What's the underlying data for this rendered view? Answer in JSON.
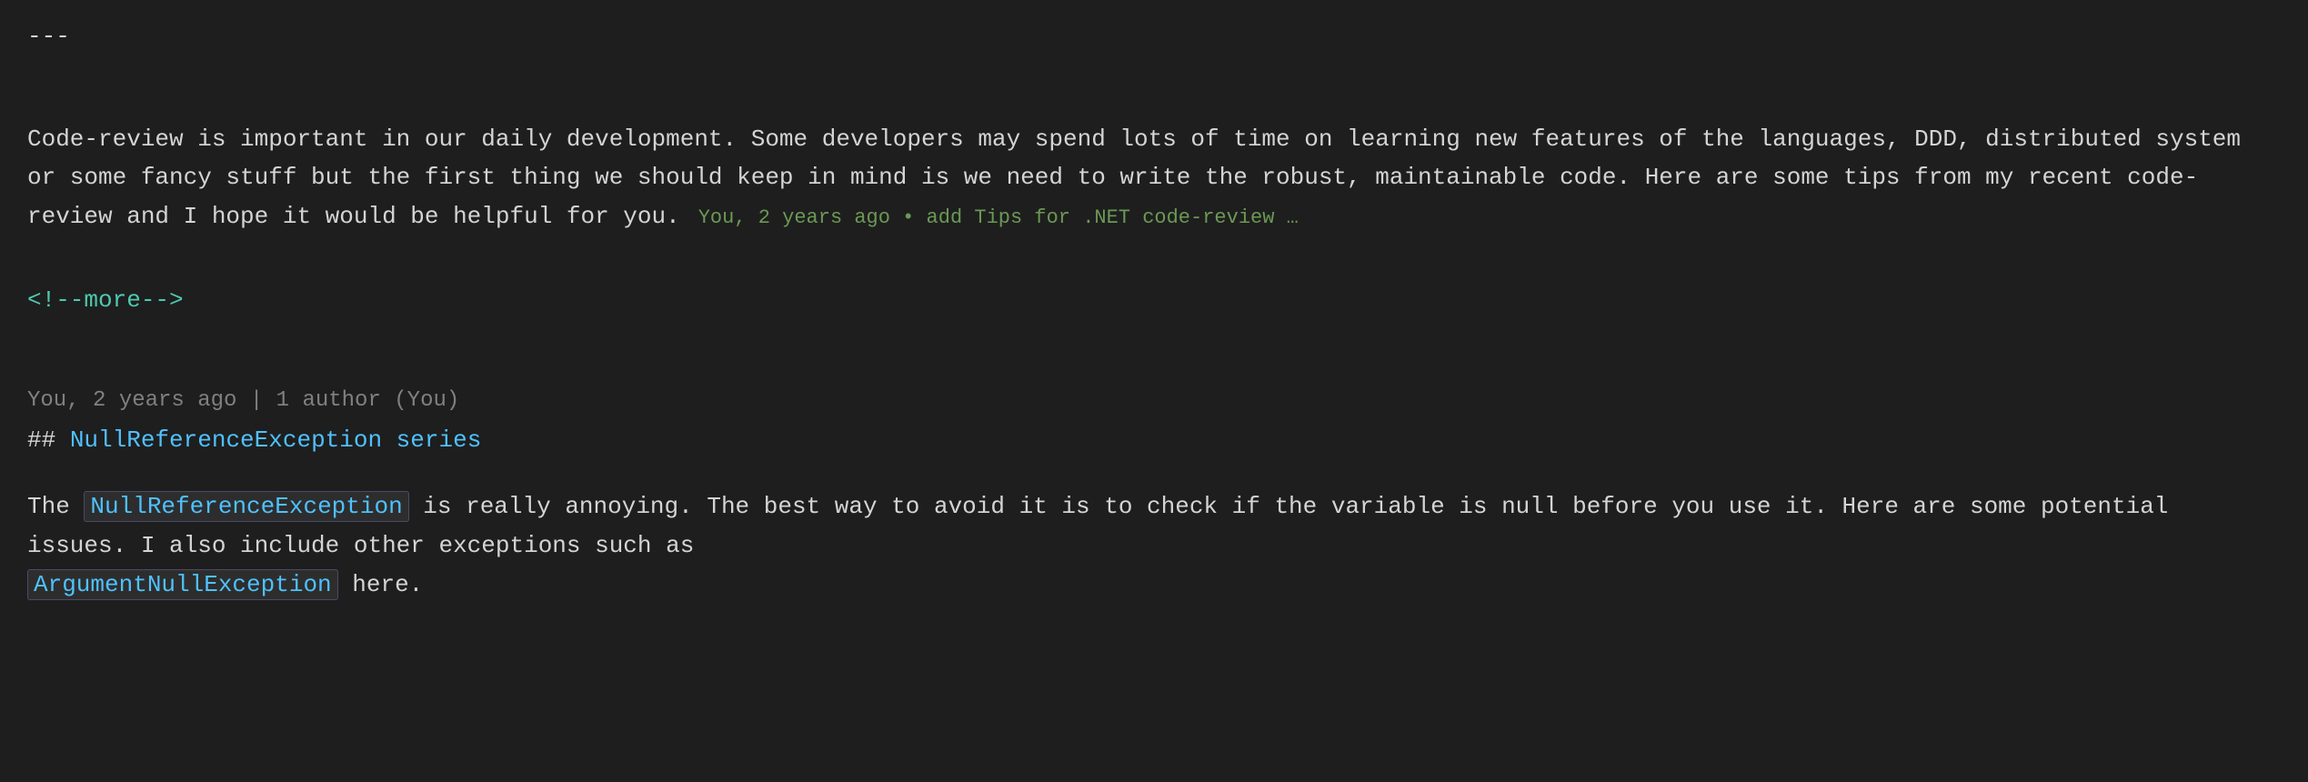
{
  "separator": "---",
  "paragraph1": {
    "text": "Code-review is important in our daily development. Some developers may spend lots of time on learning new features of the languages, DDD, distributed system or some fancy stuff but the first thing we should keep in mind is we need to write the robust, maintainable code. Here are some tips from my recent code-review and I hope it would be helpful for you.",
    "tooltip": "You, 2 years ago • add Tips for .NET code-review …"
  },
  "comment_tag": "<!--more-->",
  "section2": {
    "meta": "You, 2 years ago | 1 author (You)",
    "heading_hash": "##",
    "heading_text": " NullReferenceException series"
  },
  "paragraph2": {
    "before_code": "The ",
    "code1": "NullReferenceException",
    "after_code1": " is really annoying. The best way to avoid it is to check if the variable is null before you use it. Here are some potential issues. I also include other exceptions such as",
    "code2": "ArgumentNullException",
    "after_code2": " here."
  }
}
